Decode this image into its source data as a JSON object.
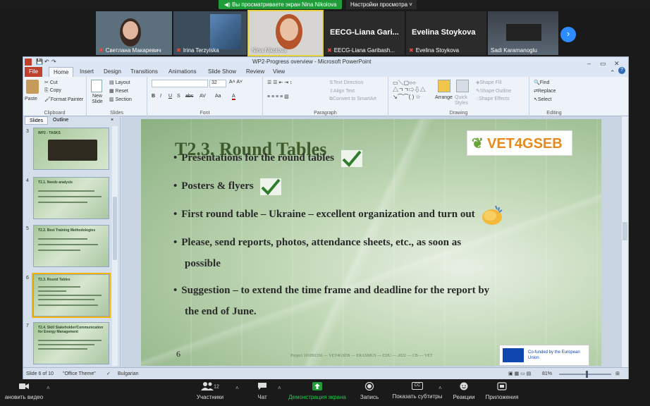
{
  "share_banner": {
    "sharing_text": "Вы просматриваете экран Nina Nikolova",
    "view_options": "Настройки просмотра"
  },
  "participants": [
    {
      "name": "Светлана Макаревич",
      "muted": true
    },
    {
      "name": "Irina Terzyiska",
      "muted": true
    },
    {
      "name": "Nina Nikolova",
      "muted": false
    },
    {
      "name": "EECG-Liana Garibash...",
      "big_name": "EECG-Liana Gari...",
      "muted": true
    },
    {
      "name": "Evelina Stoykova",
      "big_name": "Evelina Stoykova",
      "muted": true
    },
    {
      "name": "Sadi Karamanoglu",
      "muted": false
    }
  ],
  "ppt": {
    "window_title": "WP2-Progress overview - Microsoft PowerPoint",
    "quick_access": "",
    "tabs": [
      "File",
      "Home",
      "Insert",
      "Design",
      "Transitions",
      "Animations",
      "Slide Show",
      "Review",
      "View"
    ],
    "active_tab": "Home",
    "ribbon": {
      "clipboard": {
        "paste": "Paste",
        "cut": "Cut",
        "copy": "Copy",
        "format_painter": "Format Painter",
        "label": "Clipboard"
      },
      "slides": {
        "new_slide": "New Slide",
        "layout": "Layout",
        "reset": "Reset",
        "section": "Section",
        "label": "Slides"
      },
      "font": {
        "size": "32",
        "bold": "B",
        "italic": "I",
        "underline": "U",
        "strike": "S",
        "shadow": "abc",
        "spacing": "AV",
        "case": "Aa",
        "color": "A",
        "label": "Font"
      },
      "paragraph": {
        "text_direction": "Text Direction",
        "align_text": "Align Text",
        "smartart": "Convert to SmartArt",
        "label": "Paragraph"
      },
      "drawing": {
        "arrange": "Arrange",
        "quick_styles": "Quick Styles",
        "shape_fill": "Shape Fill",
        "shape_outline": "Shape Outline",
        "shape_effects": "Shape Effects",
        "label": "Drawing"
      },
      "editing": {
        "find": "Find",
        "replace": "Replace",
        "select": "Select",
        "label": "Editing"
      }
    },
    "left_panel": {
      "tabs": [
        "Slides",
        "Outline"
      ],
      "close": "×",
      "thumbs": [
        {
          "num": "3",
          "title": "WP2 - TASKS",
          "selected": false
        },
        {
          "num": "4",
          "title": "T2.1. Needs analysis",
          "selected": false
        },
        {
          "num": "5",
          "title": "T2.2. Best Training Methodologies",
          "selected": false
        },
        {
          "num": "6",
          "title": "T2.3. Round Tables",
          "selected": true
        },
        {
          "num": "7",
          "title": "T2.4. Skill Stakeholder/Communication for Energy Management",
          "selected": false
        }
      ]
    },
    "slide": {
      "title": "T2.3. Round Tables",
      "logo_text": "VET4GSEB",
      "bullets": [
        {
          "text": "Presentations for the round tables",
          "mark": "check"
        },
        {
          "text": "Posters & flyers",
          "mark": "check"
        },
        {
          "text": "First round table – Ukraine – excellent organization and turn out",
          "mark": "clap"
        },
        {
          "text": "Please, send reports, photos, attendance sheets, etc., as soon as",
          "mark": ""
        },
        {
          "text": "possible",
          "mark": "",
          "continuation": true
        },
        {
          "text": "Suggestion – to extend the time frame and deadline for the report by",
          "mark": ""
        },
        {
          "text": "the end of June.",
          "mark": "",
          "continuation": true
        }
      ],
      "number": "6",
      "footer": "Project 101092356 — VET4GSEB — ERASMUS — EDU — 2022 — CB — VET",
      "eu_text": "Co-funded by the European Union"
    },
    "status": {
      "slide_pos": "Slide 6 of 10",
      "theme": "\"Office Theme\"",
      "language": "Bulgarian",
      "zoom": "81%"
    }
  },
  "zoom_bar": {
    "stop_video": "ановить видео",
    "participants_count": "12",
    "participants": "Участники",
    "chat": "Чат",
    "share_screen": "Демонстрация экрана",
    "record": "Запись",
    "captions": "Показать субтитры",
    "reactions": "Реакции",
    "apps": "Приложения"
  },
  "colors": {
    "share_green": "#1f9d3a",
    "zoom_blue": "#2d8cff",
    "slide_title": "#3e5a2b",
    "file_tab": "#c1402c"
  }
}
